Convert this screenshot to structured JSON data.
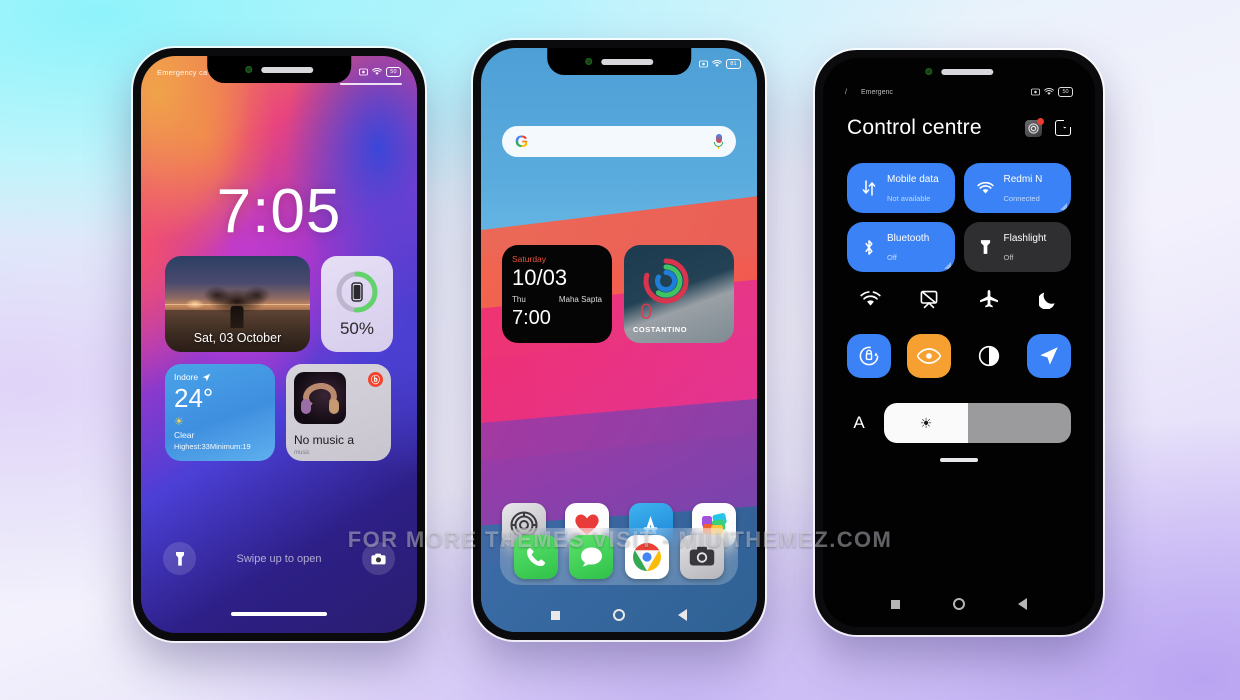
{
  "watermark": "FOR MORE THEMES VISIT - MIUITHEMEZ.COM",
  "colors": {
    "accent_blue": "#3b82f6",
    "accent_orange": "#f5a030",
    "tile_off": "#2f2f32",
    "battery_green": "#62d26a",
    "calendar_red": "#e8543f"
  },
  "phone1": {
    "name": "Lock screen",
    "status": {
      "carrier": "Emergency ca",
      "battery": "50",
      "icons": [
        "screenshot-icon",
        "wifi-icon"
      ]
    },
    "clock": "7:05",
    "photo_widget": {
      "caption": "Sat, 03 October"
    },
    "battery_widget": {
      "percent": "50%",
      "value": 50
    },
    "weather_widget": {
      "city": "Indore",
      "temperature": "24°",
      "condition": "Clear",
      "minmax": "Highest:33Minimum:19"
    },
    "music_widget": {
      "title": "No music a",
      "subtitle": "music"
    },
    "footer": {
      "hint": "Swipe up to open",
      "left_icon": "flashlight-icon",
      "right_icon": "camera-icon"
    }
  },
  "phone2": {
    "name": "Home screen",
    "status": {
      "battery": "81",
      "icons": [
        "screenshot-icon",
        "wifi-icon"
      ]
    },
    "search": {
      "logo": "G",
      "placeholder": "",
      "mic": "mic-icon"
    },
    "calendar_widget": {
      "day_of_week": "Saturday",
      "date": "10/03",
      "short_day": "Thu",
      "event": "Maha Sapta",
      "time": "7:00"
    },
    "fitness_widget": {
      "value": "0",
      "name": "COSTANTINO"
    },
    "apps": [
      {
        "label": "Settings",
        "icon": "settings-icon"
      },
      {
        "label": "Security",
        "icon": "security-heart-icon"
      },
      {
        "label": "Play Store",
        "icon": "app-store-icon"
      },
      {
        "label": "Themes",
        "icon": "themes-icon"
      }
    ],
    "dock": [
      {
        "label": "Phone",
        "icon": "phone-icon"
      },
      {
        "label": "Messages",
        "icon": "messages-icon"
      },
      {
        "label": "Chrome",
        "icon": "chrome-icon"
      },
      {
        "label": "Camera",
        "icon": "camera-icon"
      }
    ],
    "navbar": [
      "recents-square-icon",
      "home-circle-icon",
      "back-triangle-icon"
    ]
  },
  "phone3": {
    "name": "Control centre",
    "status": {
      "carrier": "Emergenc",
      "battery": "50",
      "icons": [
        "screenshot-icon",
        "wifi-icon"
      ]
    },
    "title": "Control centre",
    "header_actions": [
      {
        "icon": "settings-gear-icon",
        "badge": true
      },
      {
        "icon": "edit-pencil-icon",
        "badge": false
      }
    ],
    "tiles": [
      {
        "name": "Mobile data",
        "sub": "Not available",
        "state": "on",
        "icon": "mobile-data-icon",
        "corner": false
      },
      {
        "name": "Redmi N",
        "sub": "Connected",
        "state": "on",
        "icon": "wifi-icon",
        "corner": true
      },
      {
        "name": "Bluetooth",
        "sub": "Off",
        "state": "on",
        "icon": "bluetooth-icon",
        "corner": true
      },
      {
        "name": "Flashlight",
        "sub": "Off",
        "state": "off",
        "icon": "flashlight-icon",
        "corner": false
      }
    ],
    "quick_icons": [
      {
        "icon": "hotspot-icon"
      },
      {
        "icon": "cast-off-icon"
      },
      {
        "icon": "airplane-icon"
      },
      {
        "icon": "dnd-moon-icon"
      }
    ],
    "toggles": [
      {
        "icon": "auto-rotate-icon",
        "state": "on-blue"
      },
      {
        "icon": "eye-care-icon",
        "state": "on-orange"
      },
      {
        "icon": "dark-mode-icon",
        "state": "off"
      },
      {
        "icon": "location-icon",
        "state": "on-blue"
      }
    ],
    "brightness": {
      "auto_label": "A",
      "icon": "brightness-sun-icon",
      "level": 45
    },
    "navbar": [
      "recents-square-icon",
      "home-circle-icon",
      "back-triangle-icon"
    ]
  }
}
